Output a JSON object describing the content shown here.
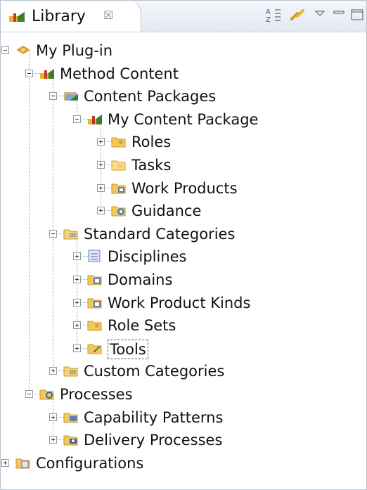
{
  "view": {
    "title": "Library",
    "close_glyph": "☒",
    "toolbar_icons": [
      "sort-icon",
      "link-editor-icon",
      "view-menu-icon",
      "minimize-icon",
      "maximize-icon"
    ]
  },
  "tree": {
    "nodes": [
      {
        "label": "My Plug-in",
        "icon": "plugin-icon",
        "expanded": true
      },
      {
        "label": "Method Content",
        "icon": "method-content-icon",
        "expanded": true
      },
      {
        "label": "Content Packages",
        "icon": "content-packages-icon",
        "expanded": true
      },
      {
        "label": "My Content Package",
        "icon": "content-package-icon",
        "expanded": true
      },
      {
        "label": "Roles",
        "icon": "roles-folder-icon",
        "expanded": false
      },
      {
        "label": "Tasks",
        "icon": "tasks-folder-icon",
        "expanded": false
      },
      {
        "label": "Work Products",
        "icon": "work-products-folder-icon",
        "expanded": false
      },
      {
        "label": "Guidance",
        "icon": "guidance-folder-icon",
        "expanded": false
      },
      {
        "label": "Standard Categories",
        "icon": "standard-categories-icon",
        "expanded": true
      },
      {
        "label": "Disciplines",
        "icon": "disciplines-icon",
        "expanded": false
      },
      {
        "label": "Domains",
        "icon": "domains-icon",
        "expanded": false
      },
      {
        "label": "Work Product Kinds",
        "icon": "work-product-kinds-icon",
        "expanded": false
      },
      {
        "label": "Role Sets",
        "icon": "role-sets-icon",
        "expanded": false
      },
      {
        "label": "Tools",
        "icon": "tools-icon",
        "expanded": false,
        "selected": true
      },
      {
        "label": "Custom Categories",
        "icon": "custom-categories-icon",
        "expanded": false
      },
      {
        "label": "Processes",
        "icon": "processes-icon",
        "expanded": true
      },
      {
        "label": "Capability Patterns",
        "icon": "capability-patterns-icon",
        "expanded": false
      },
      {
        "label": "Delivery Processes",
        "icon": "delivery-processes-icon",
        "expanded": false
      },
      {
        "label": "Configurations",
        "icon": "configurations-icon",
        "expanded": false
      }
    ]
  }
}
